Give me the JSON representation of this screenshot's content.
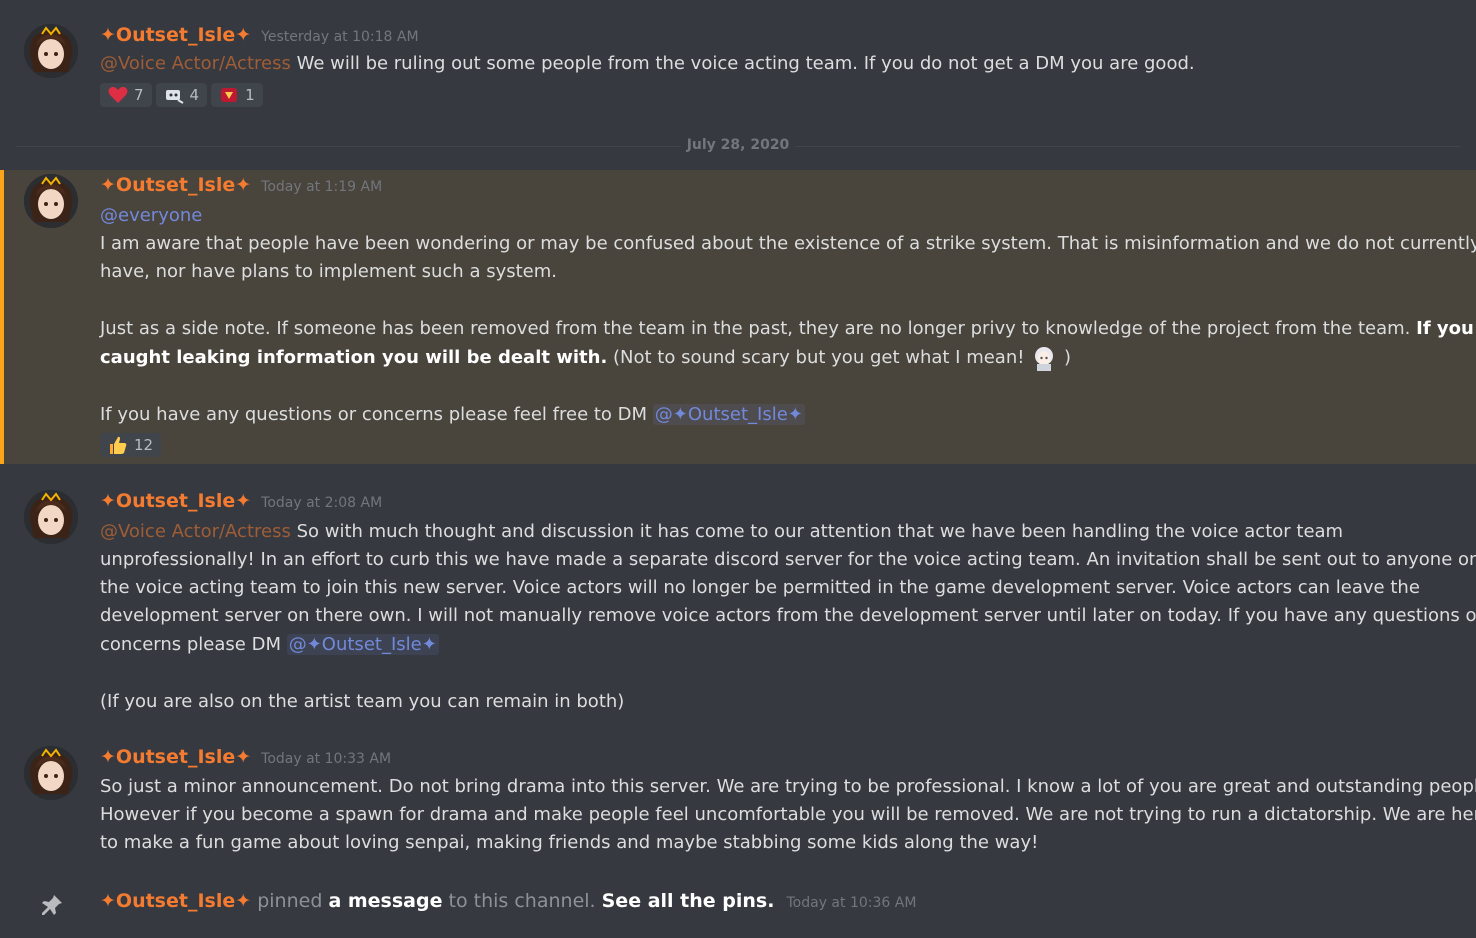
{
  "date_divider": "July 28, 2020",
  "messages": [
    {
      "username": "✦Outset_Isle✦",
      "timestamp": "Yesterday at 10:18 AM",
      "role_mention": "@Voice Actor/Actress",
      "text": "We will be ruling out some people from the voice acting team. If you do not get a DM you are good.",
      "reactions": [
        {
          "emoji": "heart-emoji",
          "count": "7"
        },
        {
          "emoji": "robot-emoji",
          "count": "4"
        },
        {
          "emoji": "red-emoji",
          "count": "1"
        }
      ]
    },
    {
      "username": "✦Outset_Isle✦",
      "timestamp": "Today at 1:19 AM",
      "everyone": "@everyone",
      "p1_l1": "I am aware that people have been wondering or may be confused about the existence of a strike system. That is misinformation and we do not currently",
      "p1_l2": "have, nor have plans to implement such a system.",
      "p2_l1": "Just as a side note. If someone has been removed from the team in the past, they are no longer privy to knowledge of the project from the team.",
      "p2_bold1": "If you are",
      "p2_bold2": "caught leaking information you will be dealt with.",
      "p2_rest": "(Not to sound scary but you get what I mean!",
      "p2_close": ")",
      "p3": "If you have any questions or concerns please feel free to DM",
      "user_mention": "@✦Outset_Isle✦",
      "reactions": [
        {
          "emoji": "thumbs-up-emoji",
          "count": "12"
        }
      ]
    },
    {
      "username": "✦Outset_Isle✦",
      "timestamp": "Today at 2:08 AM",
      "role_mention": "@Voice Actor/Actress",
      "l1": "So with much thought and discussion it has come to our attention that we have been handling the voice actor team",
      "l2": "unprofessionally! In an effort to curb this we have made a separate discord server for the voice acting team. An invitation shall be sent out to anyone on",
      "l3": "the voice acting team to join this new server. Voice actors will no longer be permitted in the game development server. Voice actors can leave the",
      "l4": "development server on there own. I will not manually remove voice actors from the development server until later on today. If you have any questions or",
      "l5": "concerns please DM",
      "user_mention": "@✦Outset_Isle✦",
      "l6": "(If you are also on the artist team you can remain in both)"
    },
    {
      "username": "✦Outset_Isle✦",
      "timestamp": "Today at 10:33 AM",
      "l1": "So just a minor announcement. Do not bring drama into this server. We are trying to be professional. I know a lot of you are great and outstanding people!",
      "l2": "However if you become a spawn for drama and make people feel uncomfortable you will be removed. We are not trying to run a dictatorship. We are here",
      "l3": "to make a fun game about loving senpai, making friends and maybe stabbing some kids along the way!"
    }
  ],
  "system": {
    "username": "✦Outset_Isle✦",
    "pinned": "pinned",
    "a_message": "a message",
    "to_channel": "to this channel.",
    "see_pins": "See all the pins.",
    "timestamp": "Today at 10:36 AM"
  },
  "colors": {
    "username": "#f47b30",
    "mention": "#7289da",
    "highlight": "#49443c",
    "highlight_bar": "#faa61a"
  }
}
